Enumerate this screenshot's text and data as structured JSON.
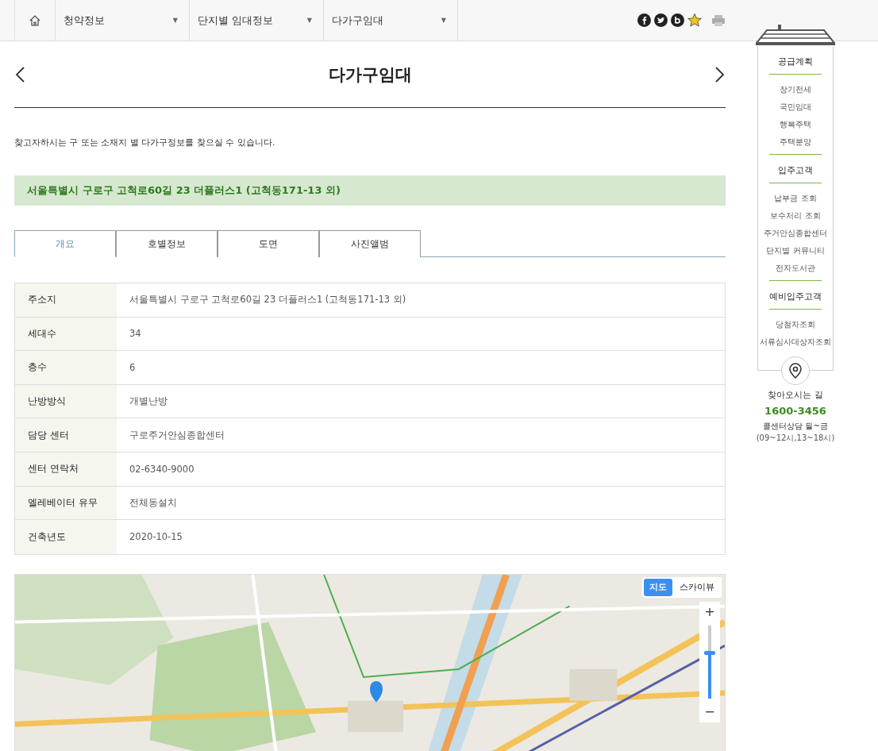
{
  "nav": {
    "menus": [
      {
        "label": "청약정보",
        "caret": "▼"
      },
      {
        "label": "단지별 임대정보",
        "caret": "▼"
      },
      {
        "label": "다가구임대",
        "caret": "▼"
      }
    ]
  },
  "page": {
    "title": "다가구임대",
    "description": "찾고자하시는 구 또는 소재지 별 다가구정보를 찾으실 수 있습니다.",
    "address_banner": "서울특별시 구로구 고척로60길 23 더플러스1 (고척동171-13 외)"
  },
  "tabs": [
    {
      "label": "개요",
      "selected": true
    },
    {
      "label": "호별정보",
      "selected": false
    },
    {
      "label": "도면",
      "selected": false
    },
    {
      "label": "사진앨범",
      "selected": false
    }
  ],
  "info_rows": [
    {
      "label": "주소지",
      "value": "서울특별시 구로구 고척로60길 23 더플러스1 (고척동171-13 외)"
    },
    {
      "label": "세대수",
      "value": "34"
    },
    {
      "label": "층수",
      "value": "6"
    },
    {
      "label": "난방방식",
      "value": "개별난방"
    },
    {
      "label": "담당 센터",
      "value": "구로주거안심종합센터"
    },
    {
      "label": "센터 연락처",
      "value": "02-6340-9000"
    },
    {
      "label": "엘레베이터 유무",
      "value": "전체동설치"
    },
    {
      "label": "건축년도",
      "value": "2020-10-15"
    }
  ],
  "map": {
    "kind": "picture",
    "view_toggle": [
      {
        "label": "지도",
        "selected": true
      },
      {
        "label": "스카이뷰",
        "selected": false
      }
    ],
    "zoom_in": "+",
    "zoom_out": "−",
    "zoom": {
      "level": 0.62
    }
  },
  "quick_menu": {
    "sections": [
      {
        "title": "공급계획",
        "items": [
          "장기전세",
          "국민임대",
          "행복주택",
          "주택분양"
        ]
      },
      {
        "title": "입주고객",
        "items": [
          "납부금 조회",
          "보수처리 조회",
          "주거안심종합센터",
          "단지별 커뮤니티",
          "전자도서관"
        ]
      },
      {
        "title": "예비입주고객",
        "items": [
          "당첨자조회",
          "서류심사대상자조회"
        ]
      }
    ],
    "directions": "찾아오시는 길",
    "phone": "1600-3456",
    "hours_label": "콜센터상담 월~금",
    "hours": "(09~12시,13~18시)"
  }
}
